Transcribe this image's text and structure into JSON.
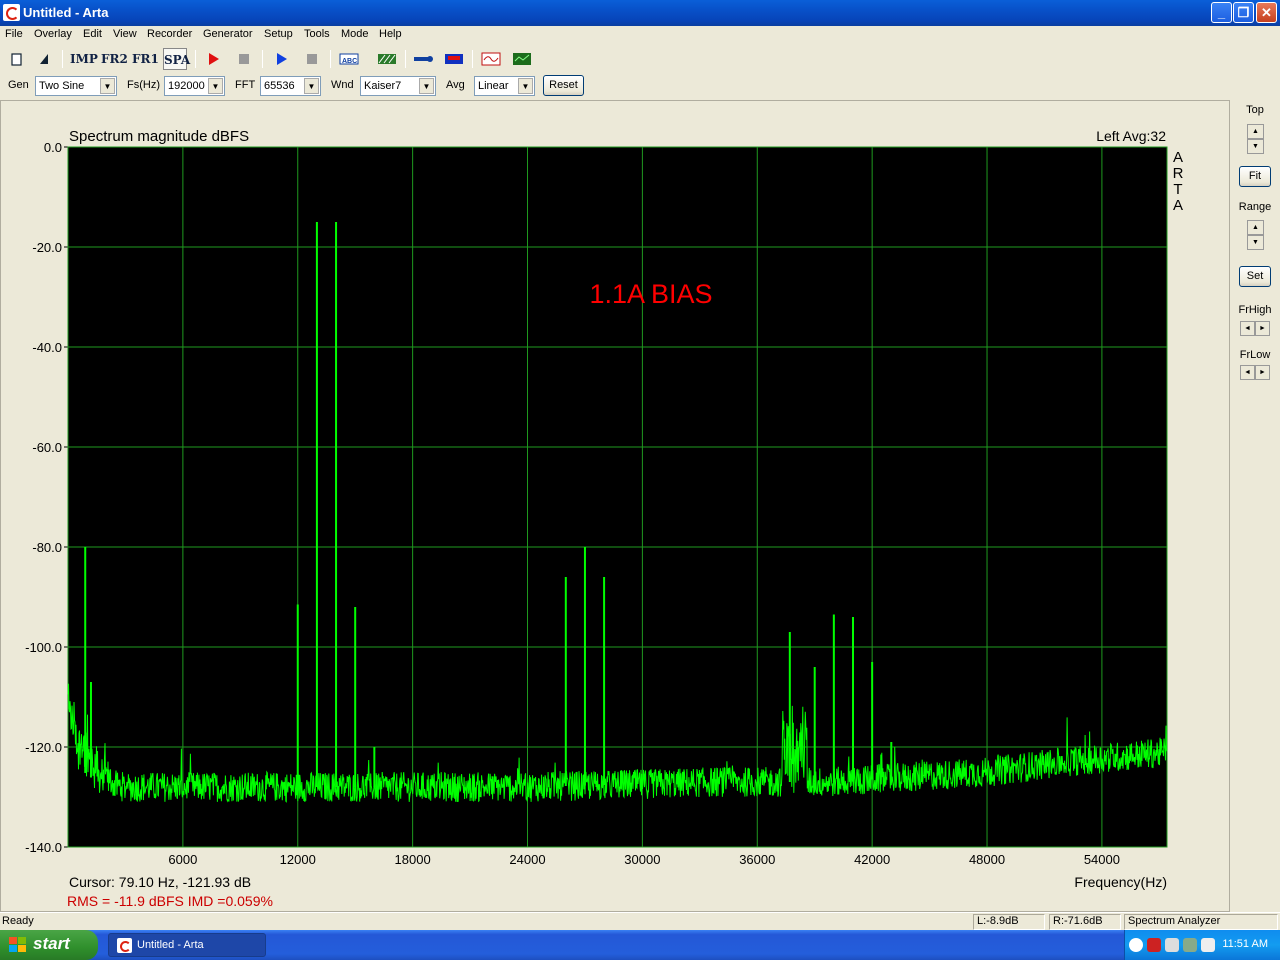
{
  "window": {
    "title": "Untitled - Arta"
  },
  "menu": [
    "File",
    "Overlay",
    "Edit",
    "View",
    "Recorder",
    "Generator",
    "Setup",
    "Tools",
    "Mode",
    "Help"
  ],
  "toolbar": {
    "mode_buttons": [
      "IMP",
      "FR2",
      "FR1",
      "SPA"
    ],
    "selected_mode": "SPA"
  },
  "controls": {
    "gen_label": "Gen",
    "gen_value": "Two Sine",
    "fs_label": "Fs(Hz)",
    "fs_value": "192000",
    "fft_label": "FFT",
    "fft_value": "65536",
    "wnd_label": "Wnd",
    "wnd_value": "Kaiser7",
    "avg_label": "Avg",
    "avg_value": "Linear",
    "reset_label": "Reset"
  },
  "side_panel": {
    "top_label": "Top",
    "fit_label": "Fit",
    "range_label": "Range",
    "set_label": "Set",
    "frhigh_label": "FrHigh",
    "frlow_label": "FrLow"
  },
  "plot": {
    "header_left": "Spectrum magnitude dBFS",
    "header_right": "Left  Avg:32",
    "brand_vertical": [
      "A",
      "R",
      "T",
      "A"
    ],
    "annotation": "1.1A BIAS",
    "cursor_text": "Cursor: 79.10 Hz, -121.93 dB",
    "rms_text": "RMS =  -11.9 dBFS   IMD =0.059%",
    "background": "#000000",
    "grid_color": "#1f9a1f",
    "trace_color": "#00ff00",
    "annotation_color": "#ff0000"
  },
  "chart_data": {
    "type": "line",
    "title": "Spectrum magnitude dBFS",
    "xlabel": "Frequency(Hz)",
    "ylabel": "",
    "xlim": [
      0,
      57400
    ],
    "ylim": [
      -140,
      0
    ],
    "x_ticks": [
      "6000",
      "12000",
      "18000",
      "24000",
      "30000",
      "36000",
      "42000",
      "48000",
      "54000"
    ],
    "y_ticks": [
      "0.0",
      "-20.0",
      "-40.0",
      "-60.0",
      "-80.0",
      "-100.0",
      "-120.0",
      "-140.0"
    ],
    "grid": true,
    "noise_floor": {
      "x": [
        0,
        500,
        1500,
        3000,
        12000,
        24000,
        34000,
        36000,
        40000,
        44000,
        48000,
        52000,
        57400
      ],
      "y": [
        -118,
        -124,
        -127,
        -128,
        -128,
        -128,
        -127,
        -127,
        -127,
        -126,
        -125,
        -123,
        -121
      ]
    },
    "peaks": [
      {
        "x": 900,
        "y": -80
      },
      {
        "x": 1200,
        "y": -107
      },
      {
        "x": 12000,
        "y": -91.5
      },
      {
        "x": 13000,
        "y": -15
      },
      {
        "x": 14000,
        "y": -15
      },
      {
        "x": 15000,
        "y": -92
      },
      {
        "x": 16000,
        "y": -120
      },
      {
        "x": 26000,
        "y": -86
      },
      {
        "x": 27000,
        "y": -80
      },
      {
        "x": 28000,
        "y": -86
      },
      {
        "x": 37700,
        "y": -97
      },
      {
        "x": 39000,
        "y": -104
      },
      {
        "x": 40000,
        "y": -93.5
      },
      {
        "x": 41000,
        "y": -94
      },
      {
        "x": 42000,
        "y": -103
      },
      {
        "x": 43000,
        "y": -119
      }
    ]
  },
  "status": {
    "ready": "Ready",
    "left_level": "L:-8.9dB",
    "right_level": "R:-71.6dB",
    "mode": "Spectrum Analyzer"
  },
  "taskbar": {
    "start_label": "start",
    "task_label": "Untitled - Arta",
    "clock": "11:51 AM"
  }
}
